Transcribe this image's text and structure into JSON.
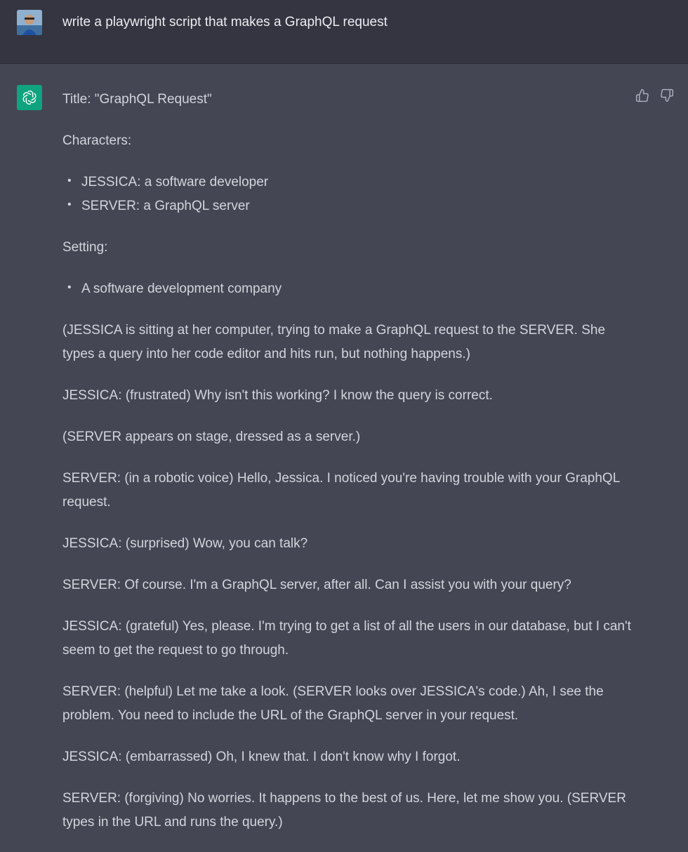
{
  "user_message": {
    "text": "write a playwright script that makes a GraphQL request"
  },
  "assistant_message": {
    "title_line": "Title: \"GraphQL Request\"",
    "characters_heading": "Characters:",
    "characters": [
      "JESSICA: a software developer",
      "SERVER: a GraphQL server"
    ],
    "setting_heading": "Setting:",
    "setting": [
      "A software development company"
    ],
    "paragraphs": [
      "(JESSICA is sitting at her computer, trying to make a GraphQL request to the SERVER. She types a query into her code editor and hits run, but nothing happens.)",
      "JESSICA: (frustrated) Why isn't this working? I know the query is correct.",
      "(SERVER appears on stage, dressed as a server.)",
      "SERVER: (in a robotic voice) Hello, Jessica. I noticed you're having trouble with your GraphQL request.",
      "JESSICA: (surprised) Wow, you can talk?",
      "SERVER: Of course. I'm a GraphQL server, after all. Can I assist you with your query?",
      "JESSICA: (grateful) Yes, please. I'm trying to get a list of all the users in our database, but I can't seem to get the request to go through.",
      "SERVER: (helpful) Let me take a look. (SERVER looks over JESSICA's code.) Ah, I see the problem. You need to include the URL of the GraphQL server in your request.",
      "JESSICA: (embarrassed) Oh, I knew that. I don't know why I forgot.",
      "SERVER: (forgiving) No worries. It happens to the best of us. Here, let me show you. (SERVER types in the URL and runs the query.)"
    ]
  },
  "icons": {
    "user_avatar": "avatar",
    "bot_avatar": "openai-logo-icon",
    "thumbs_up": "thumbs-up-icon",
    "thumbs_down": "thumbs-down-icon"
  },
  "colors": {
    "user_bg": "#343541",
    "assistant_bg": "#444654",
    "bot_avatar_bg": "#10a37f",
    "text": "#d1d5db"
  }
}
